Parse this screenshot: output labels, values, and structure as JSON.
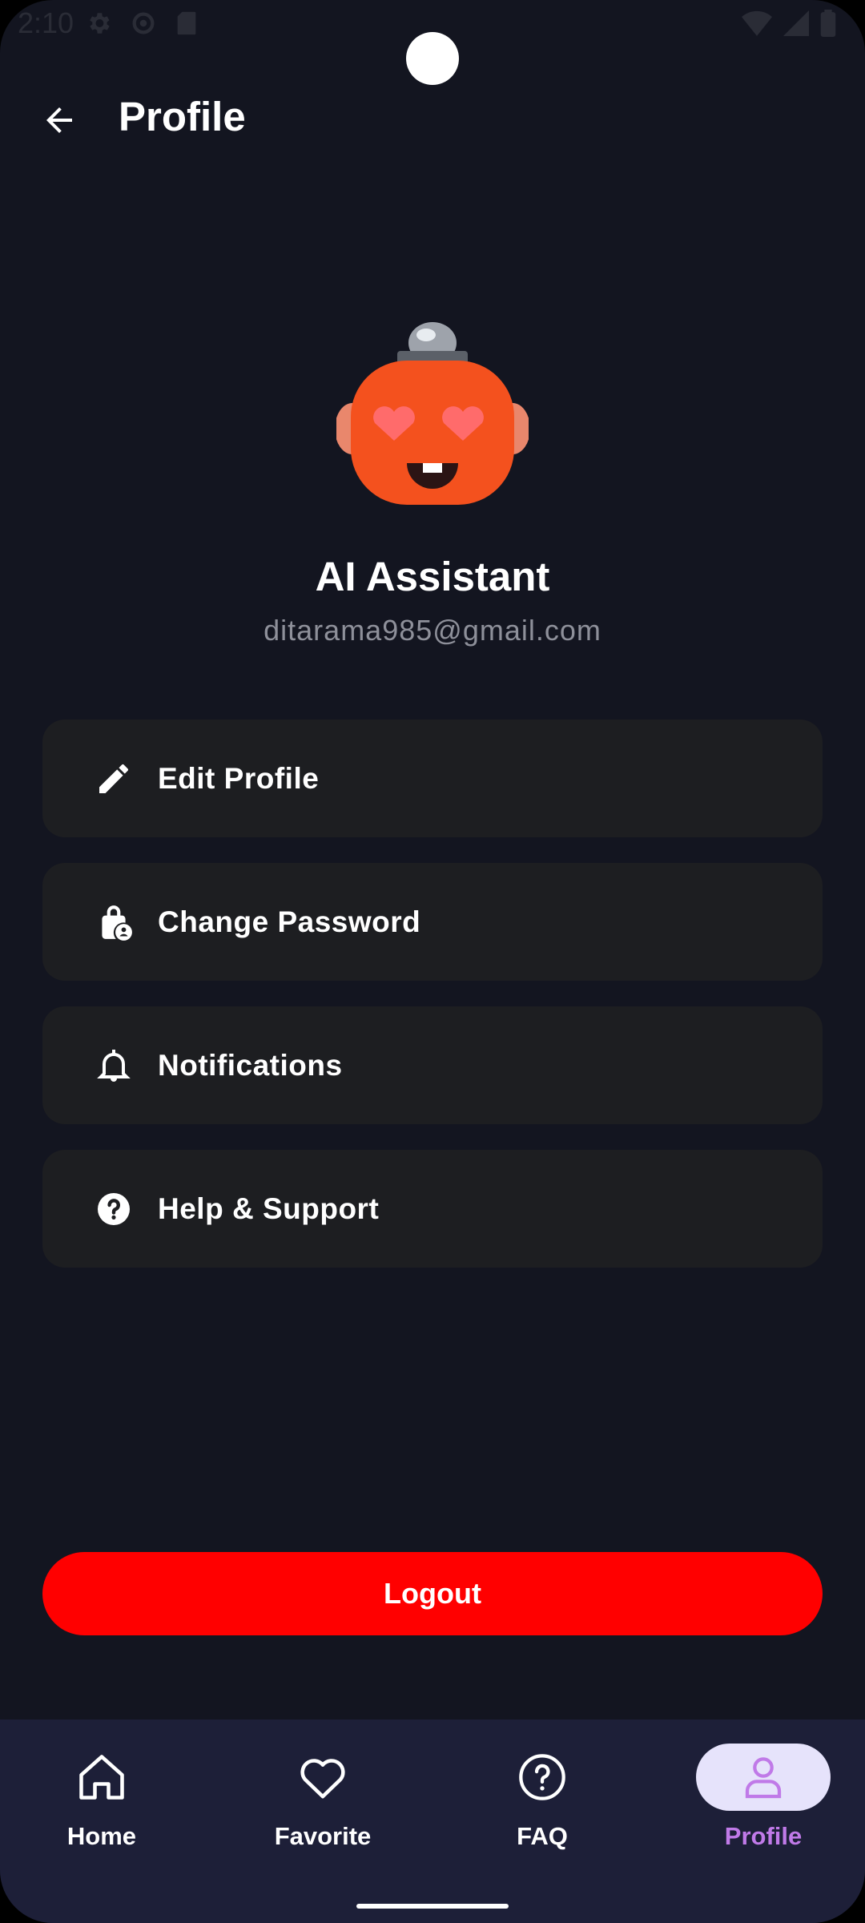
{
  "status_bar": {
    "time": "2:10",
    "left_icons": [
      "gear-icon",
      "settings-icon",
      "sd-card-icon"
    ],
    "right_icons": [
      "wifi-icon",
      "signal-icon",
      "battery-icon"
    ]
  },
  "app_bar": {
    "back_icon": "arrow-left-icon",
    "title": "Profile"
  },
  "profile": {
    "avatar": "robot-heart-eyes-avatar",
    "name": "AI Assistant",
    "email": "ditarama985@gmail.com"
  },
  "menu": {
    "items": [
      {
        "label": "Edit Profile",
        "icon": "pencil-icon"
      },
      {
        "label": "Change Password",
        "icon": "lock-person-icon"
      },
      {
        "label": "Notifications",
        "icon": "bell-icon"
      },
      {
        "label": "Help & Support",
        "icon": "help-circle-icon"
      }
    ]
  },
  "logout": {
    "label": "Logout",
    "color": "#ff0000"
  },
  "bottom_nav": {
    "items": [
      {
        "label": "Home",
        "icon": "home-icon"
      },
      {
        "label": "Favorite",
        "icon": "heart-icon"
      },
      {
        "label": "FAQ",
        "icon": "help-circle-outline-icon"
      },
      {
        "label": "Profile",
        "icon": "person-icon",
        "active": true
      }
    ],
    "active_color": "#c07ae8",
    "active_bg": "#e6e3fb"
  },
  "colors": {
    "background": "#131520",
    "card": "#1d1e21",
    "nav_background": "#1d1f38",
    "avatar_orange": "#f4511e"
  }
}
